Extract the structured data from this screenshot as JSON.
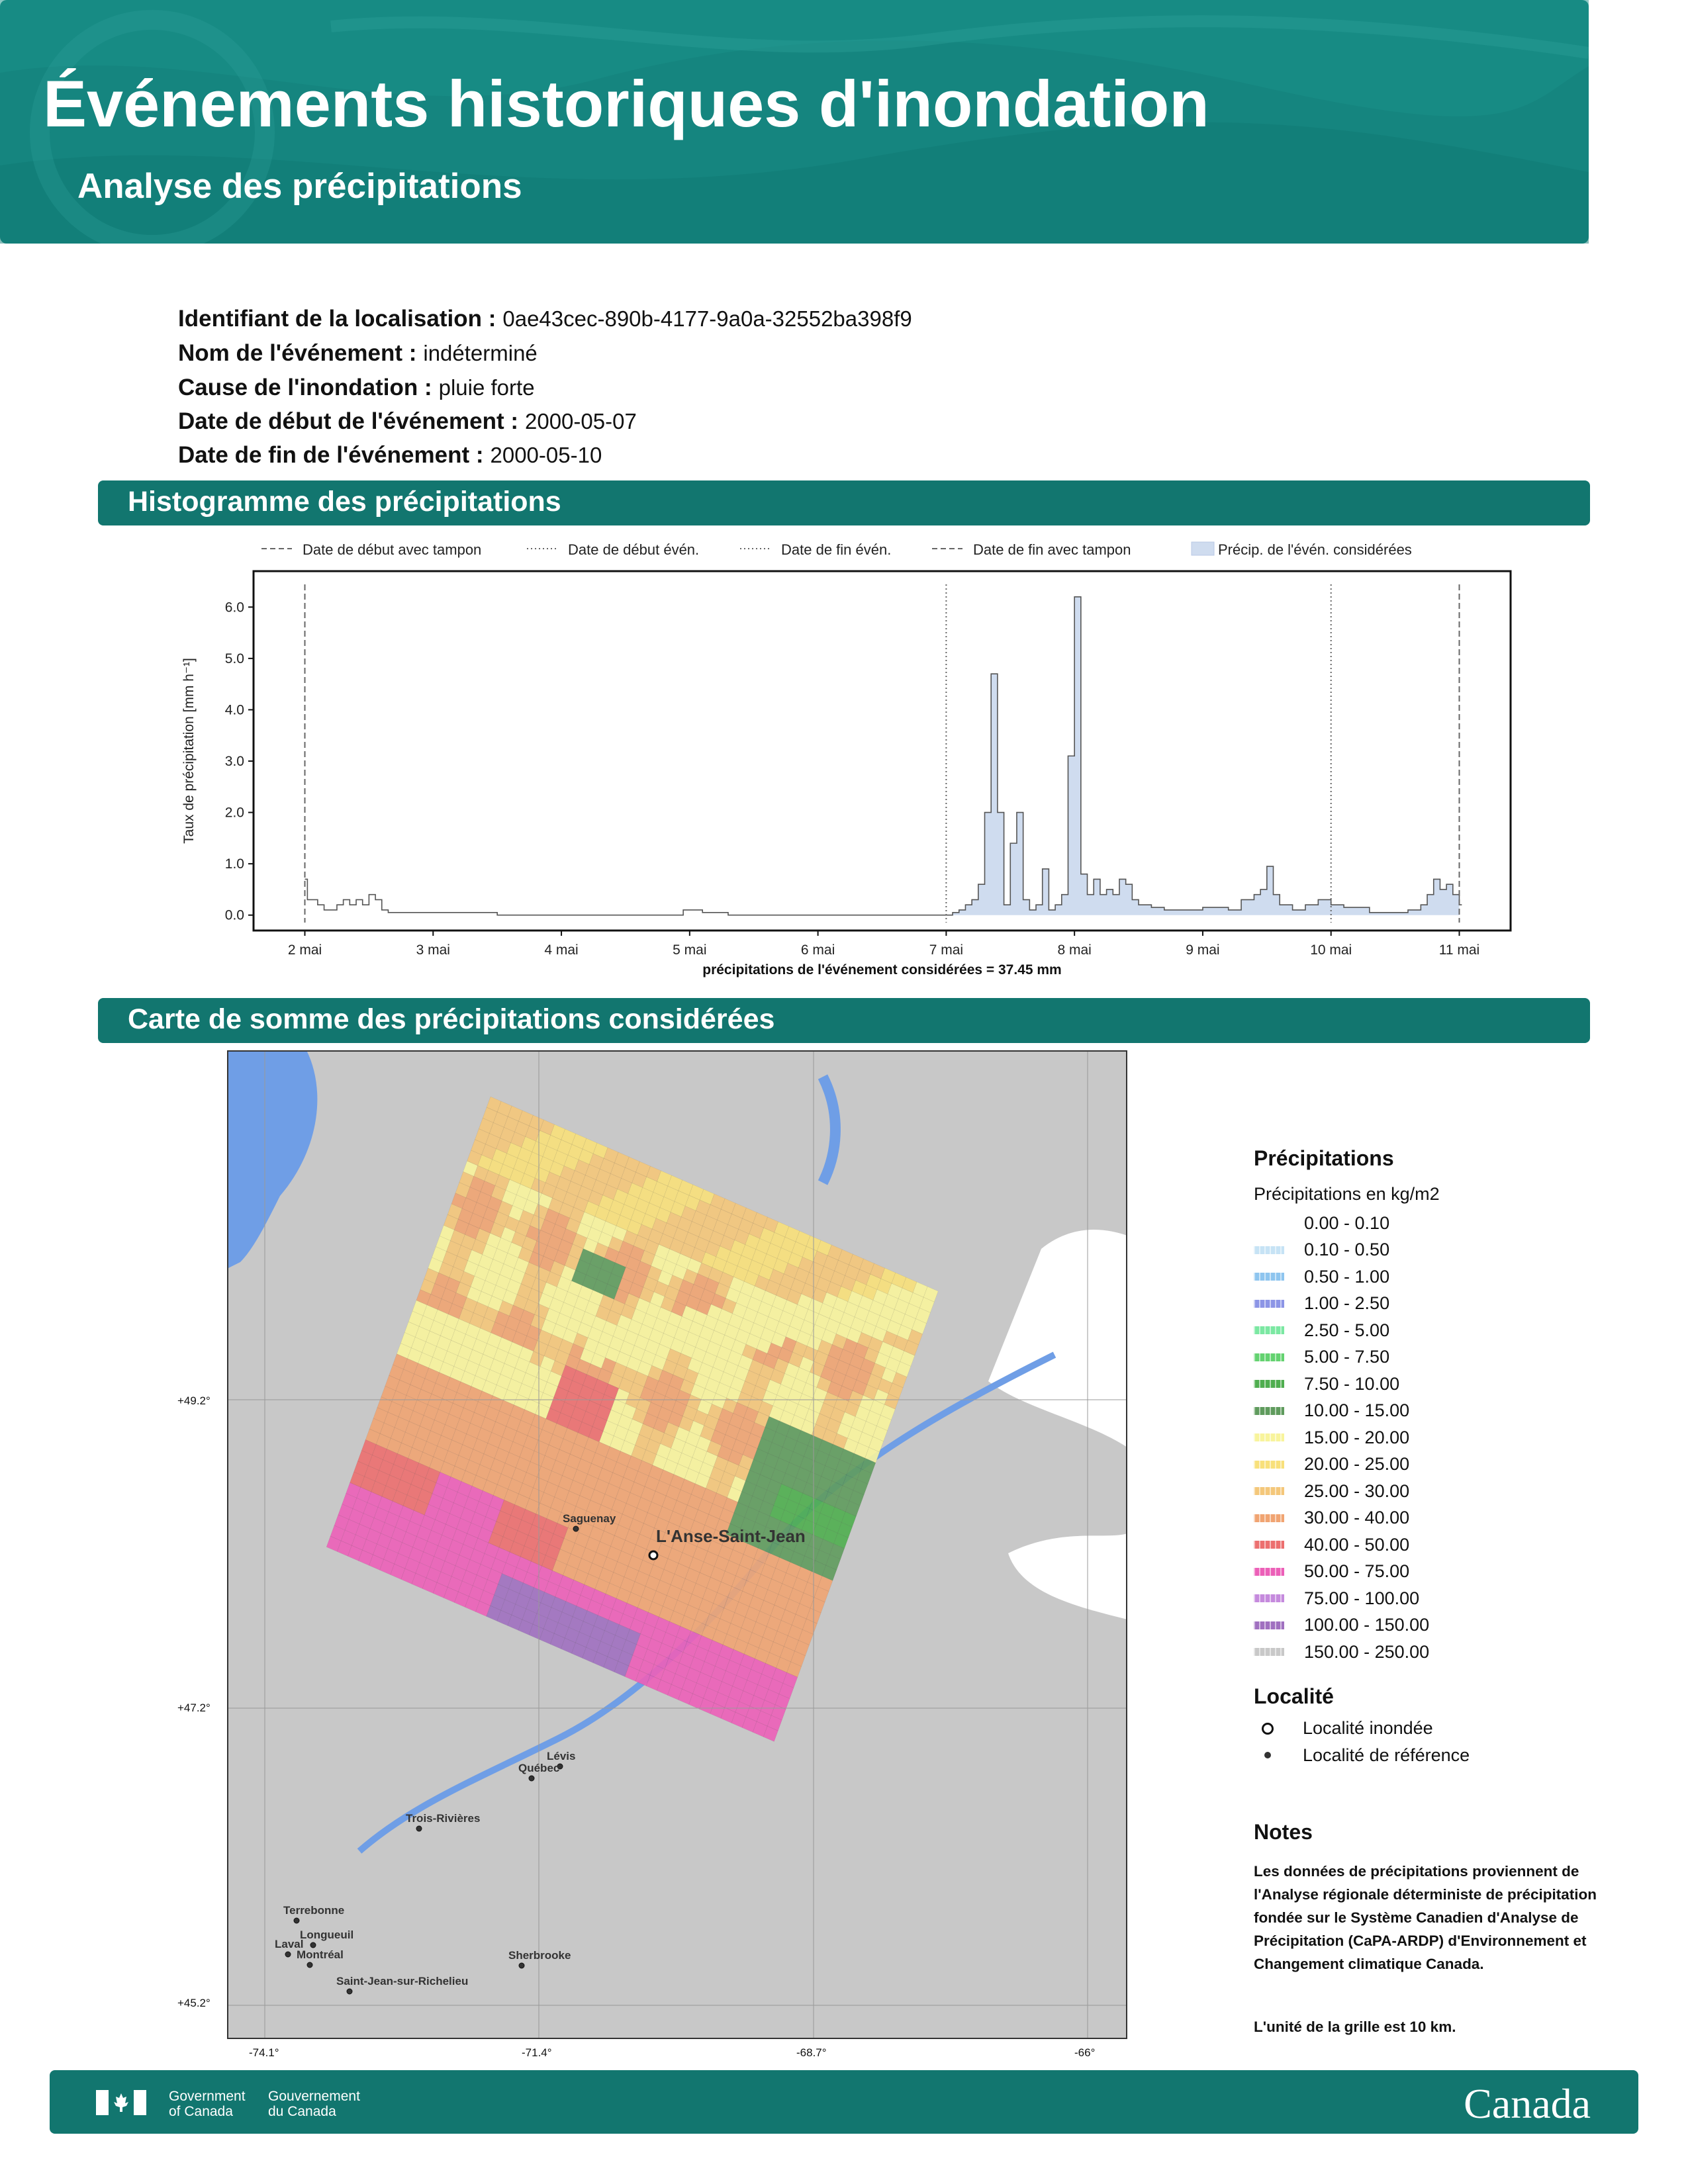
{
  "header": {
    "title": "Événements historiques d'inondation",
    "subtitle": "Analyse des précipitations"
  },
  "info": [
    {
      "label": "Identifiant de la localisation :",
      "value": "0ae43cec-890b-4177-9a0a-32552ba398f9"
    },
    {
      "label": "Nom de l'événement :",
      "value": "indéterminé"
    },
    {
      "label": "Cause de l'inondation :",
      "value": "pluie forte"
    },
    {
      "label": "Date de début de l'événement :",
      "value": "2000-05-07"
    },
    {
      "label": "Date de fin de l'événement :",
      "value": "2000-05-10"
    }
  ],
  "sections": {
    "histogram": "Histogramme des précipitations",
    "map": "Carte de somme des précipitations considérées"
  },
  "chart_data": {
    "type": "area",
    "ylabel": "Taux de précipitation [mm h⁻¹]",
    "ylim": [
      -0.3,
      6.7
    ],
    "yticks": [
      "0.0",
      "1.0",
      "2.0",
      "3.0",
      "4.0",
      "5.0",
      "6.0"
    ],
    "xticks": [
      "2 mai",
      "3 mai",
      "4 mai",
      "5 mai",
      "6 mai",
      "7 mai",
      "8 mai",
      "9 mai",
      "10 mai",
      "11 mai"
    ],
    "xlim": [
      1.6,
      11.4
    ],
    "legend_position": "top",
    "legend": [
      {
        "label": "Date de début avec tampon",
        "style": "dashed"
      },
      {
        "label": "Date de début évén.",
        "style": "dotted"
      },
      {
        "label": "Date de fin évén.",
        "style": "dotted"
      },
      {
        "label": "Date de fin avec tampon",
        "style": "dashed"
      },
      {
        "label": "Précip. de l'évén. considérées",
        "style": "fill"
      }
    ],
    "vlines": [
      {
        "x": 2.0,
        "style": "dashed"
      },
      {
        "x": 7.0,
        "style": "dotted"
      },
      {
        "x": 10.0,
        "style": "dotted"
      },
      {
        "x": 11.0,
        "style": "dashed"
      }
    ],
    "fill_range": [
      7.0,
      11.0
    ],
    "series": [
      {
        "x": [
          2.0,
          2.02,
          2.1,
          2.15,
          2.2,
          2.25,
          2.3,
          2.35,
          2.4,
          2.45,
          2.5,
          2.55,
          2.6,
          2.65,
          2.8,
          3.0,
          3.5,
          4.0,
          4.5,
          4.95,
          5.0,
          5.1,
          5.2,
          5.3,
          6.0,
          6.9,
          7.05,
          7.1,
          7.15,
          7.2,
          7.25,
          7.3,
          7.35,
          7.4,
          7.45,
          7.5,
          7.55,
          7.6,
          7.65,
          7.7,
          7.75,
          7.8,
          7.85,
          7.9,
          7.95,
          8.0,
          8.05,
          8.1,
          8.15,
          8.2,
          8.25,
          8.3,
          8.35,
          8.4,
          8.45,
          8.5,
          8.6,
          8.7,
          8.8,
          9.0,
          9.2,
          9.3,
          9.4,
          9.45,
          9.5,
          9.55,
          9.6,
          9.7,
          9.8,
          9.9,
          10.0,
          10.1,
          10.3,
          10.5,
          10.6,
          10.7,
          10.75,
          10.8,
          10.85,
          10.9,
          10.95,
          11.0
        ],
        "y": [
          0.7,
          0.3,
          0.2,
          0.1,
          0.1,
          0.2,
          0.3,
          0.2,
          0.3,
          0.2,
          0.4,
          0.3,
          0.1,
          0.05,
          0.05,
          0.05,
          0.0,
          0.0,
          0.0,
          0.1,
          0.1,
          0.05,
          0.05,
          0.0,
          0.0,
          0.0,
          0.05,
          0.1,
          0.2,
          0.3,
          0.6,
          2.0,
          4.7,
          2.0,
          0.2,
          1.4,
          2.0,
          0.3,
          0.1,
          0.2,
          0.9,
          0.1,
          0.2,
          0.4,
          3.1,
          6.2,
          0.8,
          0.4,
          0.7,
          0.4,
          0.5,
          0.4,
          0.7,
          0.6,
          0.3,
          0.2,
          0.15,
          0.1,
          0.1,
          0.15,
          0.1,
          0.3,
          0.4,
          0.5,
          0.95,
          0.4,
          0.2,
          0.1,
          0.2,
          0.3,
          0.2,
          0.15,
          0.05,
          0.05,
          0.1,
          0.2,
          0.4,
          0.7,
          0.5,
          0.6,
          0.4,
          0.2
        ]
      }
    ],
    "xlabel": "précipitations de l'événement considérées = 37.45 mm"
  },
  "map": {
    "lat_labels": [
      "+49.2°",
      "+47.2°",
      "+45.2°"
    ],
    "lon_labels": [
      "-74.1°",
      "-71.4°",
      "-68.7°",
      "-66°"
    ],
    "places": [
      {
        "name": "L'Anse-Saint-Jean",
        "kind": "inondee"
      },
      {
        "name": "Saguenay",
        "kind": "reference"
      },
      {
        "name": "Lévis",
        "kind": "reference"
      },
      {
        "name": "Québec",
        "kind": "reference"
      },
      {
        "name": "Trois-Rivières",
        "kind": "reference"
      },
      {
        "name": "Terrebonne",
        "kind": "reference"
      },
      {
        "name": "Longueuil",
        "kind": "reference"
      },
      {
        "name": "Laval",
        "kind": "reference"
      },
      {
        "name": "Montréal",
        "kind": "reference"
      },
      {
        "name": "Sherbrooke",
        "kind": "reference"
      },
      {
        "name": "Saint-Jean-sur-Richelieu",
        "kind": "reference"
      }
    ]
  },
  "legend": {
    "title": "Précipitations",
    "subtitle": "Précipitations en kg/m2",
    "classes": [
      {
        "label": "0.00 - 0.10",
        "color": "#ffffff"
      },
      {
        "label": "0.10 - 0.50",
        "color": "#c6e3f5"
      },
      {
        "label": "0.50 - 1.00",
        "color": "#8ec5ef"
      },
      {
        "label": "1.00 - 2.50",
        "color": "#8c95e6"
      },
      {
        "label": "2.50 - 5.00",
        "color": "#7be8a2"
      },
      {
        "label": "5.00 - 7.50",
        "color": "#63d270"
      },
      {
        "label": "7.50 - 10.00",
        "color": "#4fae4f"
      },
      {
        "label": "10.00 - 15.00",
        "color": "#5f9b5d"
      },
      {
        "label": "15.00 - 20.00",
        "color": "#f8f49c"
      },
      {
        "label": "20.00 - 25.00",
        "color": "#f8e07a"
      },
      {
        "label": "25.00 - 30.00",
        "color": "#f4c77a"
      },
      {
        "label": "30.00 - 40.00",
        "color": "#f0a472"
      },
      {
        "label": "40.00 - 50.00",
        "color": "#ec6f6f"
      },
      {
        "label": "50.00 - 75.00",
        "color": "#ec5fb8"
      },
      {
        "label": "75.00 - 100.00",
        "color": "#c58add"
      },
      {
        "label": "100.00 - 150.00",
        "color": "#a070c0"
      },
      {
        "label": "150.00 - 250.00",
        "color": "#c8c8c8"
      }
    ],
    "locality_title": "Localité",
    "locality_items": [
      {
        "label": "Localité inondée",
        "symbol": "open-circle"
      },
      {
        "label": "Localité de référence",
        "symbol": "dot"
      }
    ]
  },
  "notes": {
    "title": "Notes",
    "text": "Les données de précipitations proviennent de l'Analyse régionale déterministe de précipitation fondée sur le Système Canadien d'Analyse de Précipitation (CaPA-ARDP) d'Environnement et Changement climatique Canada.",
    "unit": "L'unité de la grille est 10 km."
  },
  "footer": {
    "gov_en": "Government\nof Canada",
    "gov_fr": "Gouvernement\ndu Canada",
    "wordmark": "Canada"
  }
}
